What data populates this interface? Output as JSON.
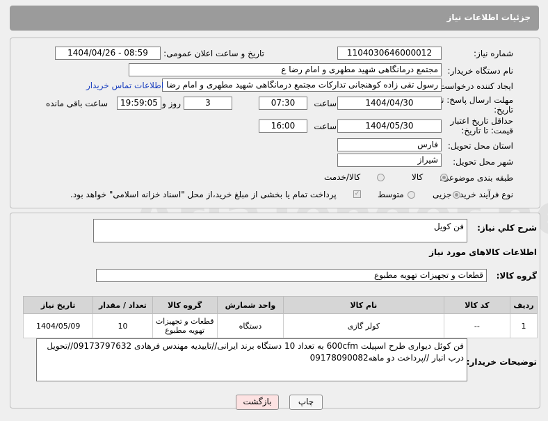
{
  "header": {
    "title": "جزئیات اطلاعات نیاز"
  },
  "fields": {
    "need_number_label": "شماره نیاز:",
    "need_number": "1104030646000012",
    "announce_label": "تاریخ و ساعت اعلان عمومی:",
    "announce_value": "1404/04/26 - 08:59",
    "buyer_org_label": "نام دستگاه خریدار:",
    "buyer_org": "مجتمع درمانگاهی شهید مطهری و امام رضا  ع",
    "requester_label": "ایجاد کننده درخواست:",
    "requester": "رسول تقی زاده کوهنجانی تدارکات مجتمع درمانگاهی شهید مطهری و امام رضا",
    "buyer_contact_link": "اطلاعات تماس خریدار",
    "reply_deadline_label": "مهلت ارسال پاسخ: تا تاریخ:",
    "reply_date": "1404/04/30",
    "time_label": "ساعت",
    "reply_time": "07:30",
    "days_value": "3",
    "day_and_label": "روز و",
    "remaining_time": "19:59:05",
    "remaining_label": "ساعت باقی مانده",
    "price_validity_label": "حداقل تاریخ اعتبار قیمت: تا تاریخ:",
    "price_date": "1404/05/30",
    "price_time_label": "ساعت",
    "price_time": "16:00",
    "province_label": "استان محل تحویل:",
    "province": "فارس",
    "city_label": "شهر محل تحویل:",
    "city": "شیراز",
    "category_label": "طبقه بندی موضوعی:",
    "category_options": [
      "کالا",
      "کالا/خدمت"
    ],
    "process_label": "نوع فرآیند خرید :",
    "process_options": [
      "جزیی",
      "متوسط"
    ],
    "payment_note": "پرداخت تمام یا بخشی از مبلغ خرید،از محل \"اسناد خزانه اسلامی\" خواهد بود."
  },
  "summary": {
    "label": "شرح کلي نياز:",
    "value": "فن کویل"
  },
  "goods_section": {
    "title": "اطلاعات کالاهای مورد نیاز",
    "group_label": "گروه کالا:",
    "group_value": "قطعات و تجهیزات تهویه مطبوع",
    "columns": [
      "ردیف",
      "کد کالا",
      "نام کالا",
      "واحد شمارش",
      "گروه کالا",
      "تعداد / مقدار",
      "تاریخ نیاز"
    ],
    "rows": [
      [
        "1",
        "--",
        "کولر گازی",
        "دستگاه",
        "قطعات و تجهیزات تهویه مطبوع",
        "10",
        "1404/05/09"
      ]
    ]
  },
  "buyer_notes": {
    "label": "توضیحات خریدار:",
    "value": "فن کوئل دیواری طرح اسپیلت 600cfm به تعداد 10 دستگاه برند ایرانی//تاییدیه مهندس فرهادی 09173797632//تحویل درب انبار //پرداخت دو ماهه09178090082"
  },
  "buttons": {
    "print": "چاپ",
    "back": "بازگشت"
  },
  "watermark": "AriaTender.net",
  "colors": {
    "header_bg": "#9b9b9b",
    "link": "#1a3fbf",
    "back_button_bg": "#fde2e2"
  }
}
